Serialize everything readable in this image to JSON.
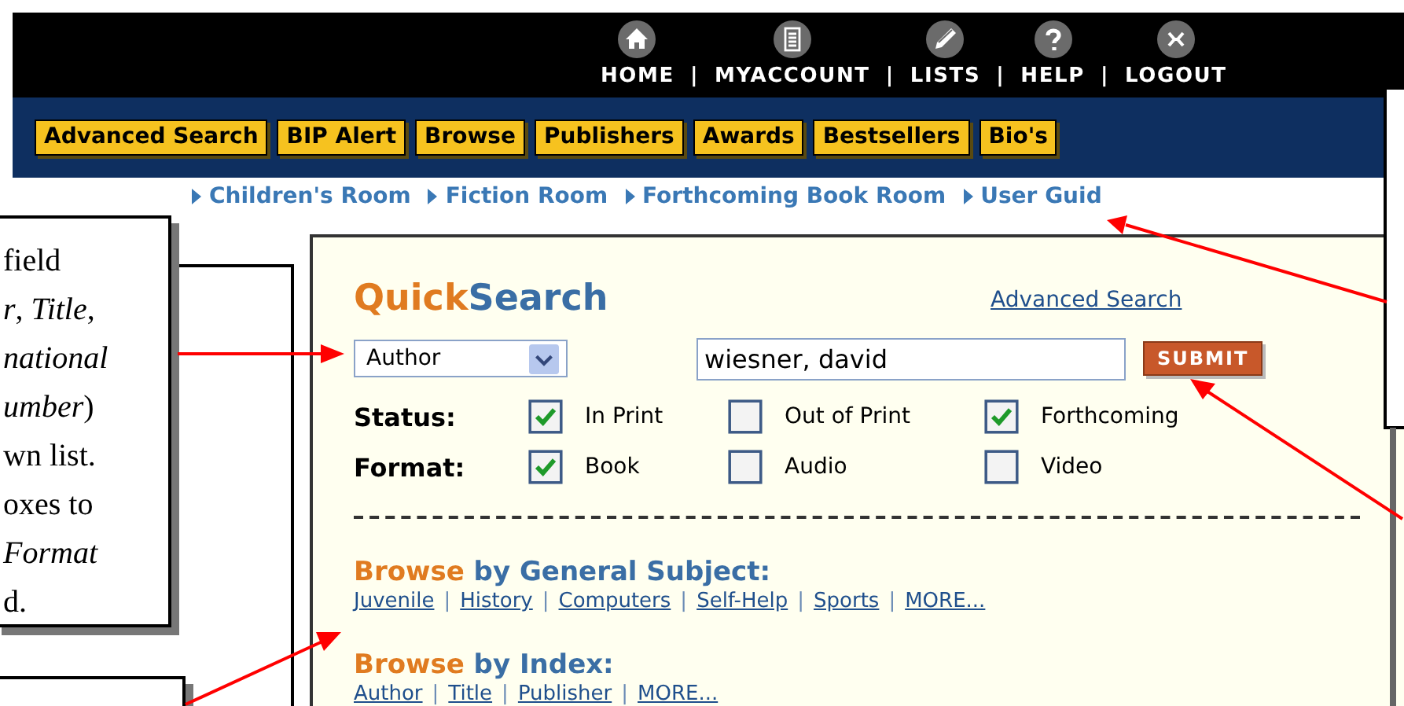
{
  "top_nav": {
    "separator": "|",
    "items": [
      {
        "label": "HOME",
        "kind": "home"
      },
      {
        "label": "MYACCOUNT",
        "kind": "document"
      },
      {
        "label": "LISTS",
        "kind": "pencil"
      },
      {
        "label": "HELP",
        "kind": "help"
      },
      {
        "label": "LOGOUT",
        "kind": "close"
      }
    ]
  },
  "tabs": [
    "Advanced Search",
    "BIP Alert",
    "Browse",
    "Publishers",
    "Awards",
    "Bestsellers",
    "Bio's"
  ],
  "room_links": [
    "Children's Room",
    "Fiction Room",
    "Forthcoming Book Room",
    "User Guid"
  ],
  "quicksearch": {
    "title_first": "Quick",
    "title_second": "Search",
    "advanced_link": "Advanced Search",
    "field_select": {
      "value": "Author"
    },
    "search_field": {
      "value": "wiesner, david"
    },
    "submit": "SUBMIT",
    "filters": [
      {
        "label": "Status:",
        "options": [
          {
            "label": "In Print",
            "checked": true
          },
          {
            "label": "Out of Print",
            "checked": false
          },
          {
            "label": "Forthcoming",
            "checked": true
          }
        ]
      },
      {
        "label": "Format:",
        "options": [
          {
            "label": "Book",
            "checked": true
          },
          {
            "label": "Audio",
            "checked": false
          },
          {
            "label": "Video",
            "checked": false
          }
        ]
      }
    ],
    "link_separator": "|",
    "browse_sections": [
      {
        "heading_first": "Browse",
        "heading_rest": "by General Subject:",
        "links": [
          "Juvenile",
          "History",
          "Computers",
          "Self-Help",
          "Sports",
          "MORE..."
        ]
      },
      {
        "heading_first": "Browse",
        "heading_rest": "by Index:",
        "links": [
          "Author",
          "Title",
          "Publisher",
          "MORE..."
        ]
      }
    ]
  },
  "callout_left": {
    "lines": [
      "field",
      "*r*, *Title*,",
      "*national*",
      "*umber*)",
      "wn list.",
      "oxes to",
      "*Format*",
      "d."
    ]
  }
}
